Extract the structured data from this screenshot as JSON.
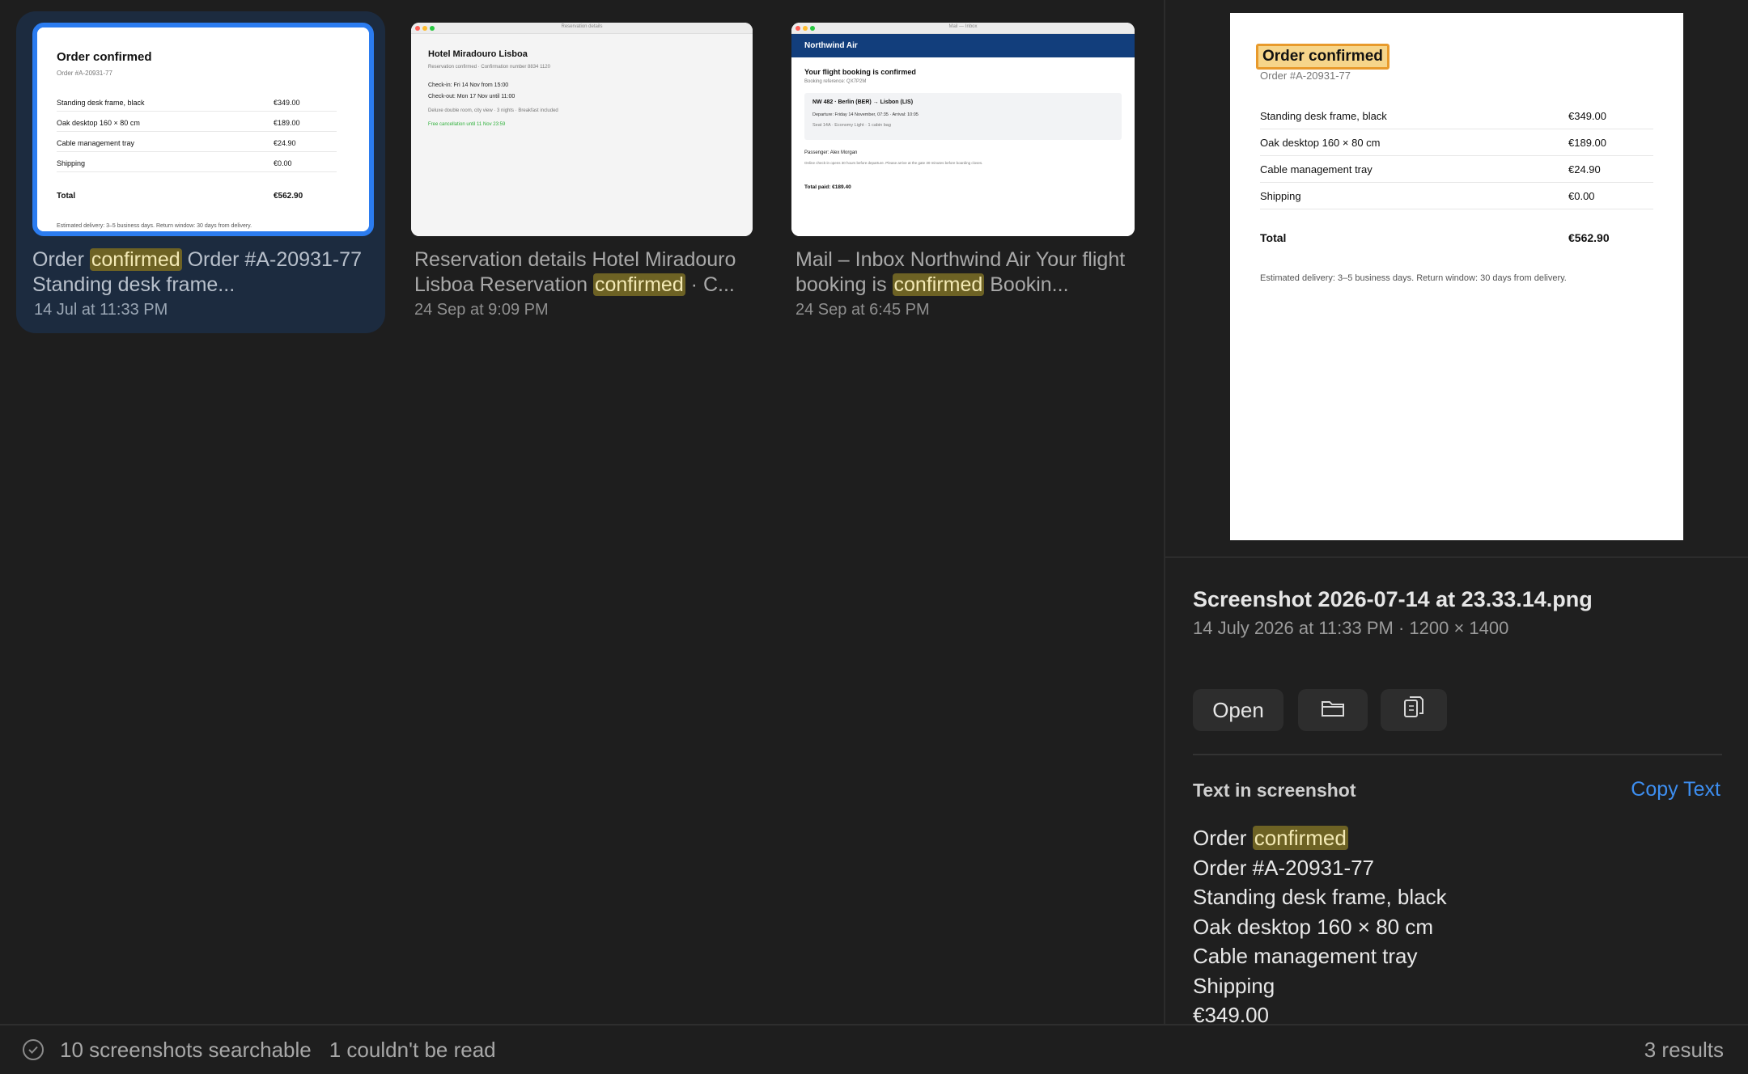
{
  "cards": [
    {
      "title_pre": "Order ",
      "title_hl": "confirmed",
      "title_post": " Order #A-20931-77 Standing desk frame...",
      "date": "14 Jul at 11:33 PM",
      "doc": {
        "heading": "Order confirmed",
        "order_no": "Order #A-20931-77",
        "items": [
          {
            "name": "Standing desk frame, black",
            "price": "€349.00"
          },
          {
            "name": "Oak desktop 160 × 80 cm",
            "price": "€189.00"
          },
          {
            "name": "Cable management tray",
            "price": "€24.90"
          },
          {
            "name": "Shipping",
            "price": "€0.00"
          }
        ],
        "total_label": "Total",
        "total_value": "€562.90",
        "note": "Estimated delivery: 3–5 business days. Return window: 30 days from delivery."
      }
    },
    {
      "title_pre": "Reservation details Hotel Miradouro Lisboa Reservation ",
      "title_hl": "confirmed",
      "title_post": " · C...",
      "date": "24 Sep at 9:09 PM",
      "doc": {
        "window_title": "Reservation details",
        "heading": "Hotel Miradouro Lisboa",
        "subline": "Reservation confirmed · Confirmation number 8834 1120",
        "checkin": "Check-in: Fri 14 Nov from 15:00",
        "checkout": "Check-out: Mon 17 Nov until 11:00",
        "room": "Deluxe double room, city view · 3 nights · Breakfast included",
        "cancel": "Free cancellation until 11 Nov 23:59"
      }
    },
    {
      "title_pre": "Mail – Inbox Northwind Air Your flight booking is ",
      "title_hl": "confirmed",
      "title_post": " Bookin...",
      "date": "24 Sep at 6:45 PM",
      "doc": {
        "window_title": "Mail — Inbox",
        "brand": "Northwind Air",
        "heading": "Your flight booking is confirmed",
        "reference": "Booking reference: QX7P2M",
        "flight": "NW 482 · Berlin (BER) → Lisbon (LIS)",
        "times": "Departure: Friday 14 November, 07:35 · Arrival: 10:05",
        "seat": "Seat 14A · Economy Light · 1 cabin bag",
        "passenger": "Passenger: Alex Morgan",
        "checkin_note": "Online check-in opens 30 hours before departure. Please arrive at the gate 30 minutes before boarding closes.",
        "total": "Total paid: €189.40"
      }
    }
  ],
  "preview": {
    "heading": "Order confirmed",
    "order_no": "Order #A-20931-77",
    "items": [
      {
        "name": "Standing desk frame, black",
        "price": "€349.00"
      },
      {
        "name": "Oak desktop 160 × 80 cm",
        "price": "€189.00"
      },
      {
        "name": "Cable management tray",
        "price": "€24.90"
      },
      {
        "name": "Shipping",
        "price": "€0.00"
      }
    ],
    "total_label": "Total",
    "total_value": "€562.90",
    "note": "Estimated delivery: 3–5 business days. Return window: 30 days from delivery."
  },
  "meta": {
    "filename": "Screenshot 2026-07-14 at 23.33.14.png",
    "details": "14 July 2026 at 11:33 PM · 1200 × 1400",
    "open_label": "Open",
    "text_section_label": "Text in screenshot",
    "copy_label": "Copy Text",
    "line1_pre": "Order ",
    "line1_hl": "confirmed",
    "lines": [
      "Order #A-20931-77",
      "Standing desk frame, black",
      "Oak desktop 160 × 80 cm",
      "Cable management tray",
      "Shipping",
      "€349.00"
    ]
  },
  "status": {
    "searchable": "10 screenshots searchable",
    "unreadable": "1 couldn't be read",
    "results": "3 results"
  },
  "colors": {
    "accent": "#2b7cf0",
    "highlight": "#6d6224",
    "link": "#3d8ef0"
  }
}
